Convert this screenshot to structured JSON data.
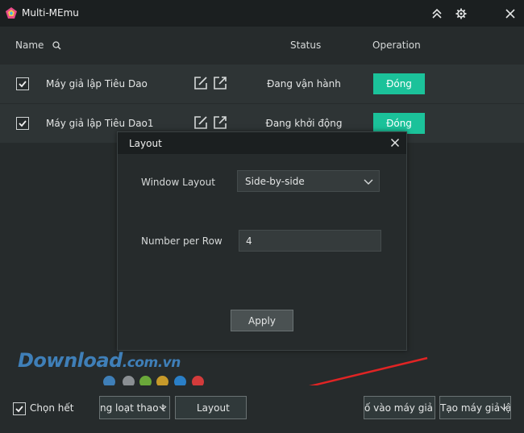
{
  "window": {
    "title": "Multi-MEmu"
  },
  "icons": {
    "logo": "memu-logo-icon",
    "pin": "double-chevron-up-icon",
    "settings": "gear-icon",
    "close": "close-icon",
    "search": "search-icon",
    "edit": "edit-icon",
    "shortcut": "external-link-icon",
    "chevron": "chevron-down-icon"
  },
  "columns": {
    "name": "Name",
    "status": "Status",
    "operation": "Operation"
  },
  "instances": [
    {
      "name": "Máy giả lập Tiêu Dao",
      "status": "Đang vận hành",
      "action": "Đóng",
      "checked": true
    },
    {
      "name": "Máy giả lập Tiêu Dao1",
      "status": "Đang khởi động",
      "action": "Đóng",
      "checked": true
    }
  ],
  "dialog": {
    "title": "Layout",
    "window_layout_label": "Window Layout",
    "window_layout_value": "Side-by-side",
    "per_row_label": "Number per Row",
    "per_row_value": "4",
    "apply_label": "Apply"
  },
  "watermark": {
    "main": "Download",
    "suffix": ".com.vn"
  },
  "bottom": {
    "select_all": "Chọn hết",
    "batch_button": "ng loạt thao t",
    "layout_button": "Layout",
    "import_button": "ố vào máy giả lậ",
    "create_button": "Tạo máy giả lậ"
  },
  "colors": {
    "accent": "#1bc29a",
    "titlebar": "#1b1f20",
    "background": "#262b2c",
    "row": "#2e3435",
    "arrow": "#e02424",
    "watermark": "#3f7fb8"
  },
  "watermark_dot_colors": [
    "#3f7fb8",
    "#8a8f93",
    "#6aa83a",
    "#c79a2a",
    "#2a7fc7",
    "#d33b3b"
  ]
}
